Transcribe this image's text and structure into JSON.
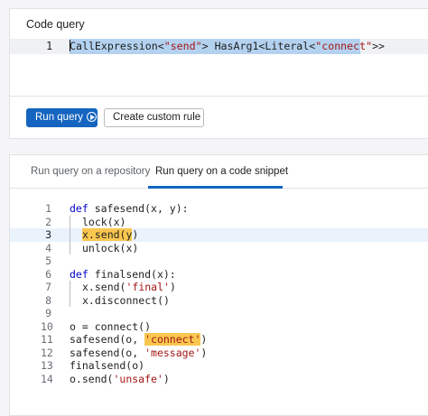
{
  "query_panel": {
    "title": "Code query",
    "line_number": "1",
    "query": {
      "first_char": "C",
      "part1": "allExpression<",
      "arg1": "\"send\"",
      "part2": "> HasArg1<Literal<",
      "arg2": "\"connect\"",
      "part3": ">>"
    },
    "run_label": "Run query",
    "custom_rule_label": "Create custom rule"
  },
  "snippet_panel": {
    "tabs": [
      {
        "label": "Run query on a repository",
        "active": false
      },
      {
        "label": "Run query on a code snippet",
        "active": true
      }
    ],
    "lines": [
      {
        "n": "1",
        "kw": "def",
        "rest": " safesend(x, y):"
      },
      {
        "n": "2",
        "text": "lock(x)"
      },
      {
        "n": "3",
        "hl": "x.send(",
        "after_hl": "y",
        "close": ")"
      },
      {
        "n": "4",
        "text": "unlock(x)"
      },
      {
        "n": "5"
      },
      {
        "n": "6",
        "kw": "def",
        "rest": " finalsend(x):"
      },
      {
        "n": "7",
        "pre": "x.send(",
        "str": "'final'",
        "post": ")"
      },
      {
        "n": "8",
        "text": "x.disconnect()"
      },
      {
        "n": "9"
      },
      {
        "n": "10",
        "text": "o = connect()"
      },
      {
        "n": "11",
        "pre": "safesend(o, ",
        "str": "'connect'",
        "post": ")"
      },
      {
        "n": "12",
        "pre": "safesend(o, ",
        "str": "'message'",
        "post": ")"
      },
      {
        "n": "13",
        "text": "finalsend(o)"
      },
      {
        "n": "14",
        "pre": "o.send(",
        "str": "'unsafe'",
        "post": ")"
      }
    ]
  },
  "colors": {
    "accent": "#1565c0",
    "selection": "#b4d2f0",
    "match_highlight": "#f9c74f",
    "string": "#a31515",
    "keyword": "#0000cc"
  }
}
